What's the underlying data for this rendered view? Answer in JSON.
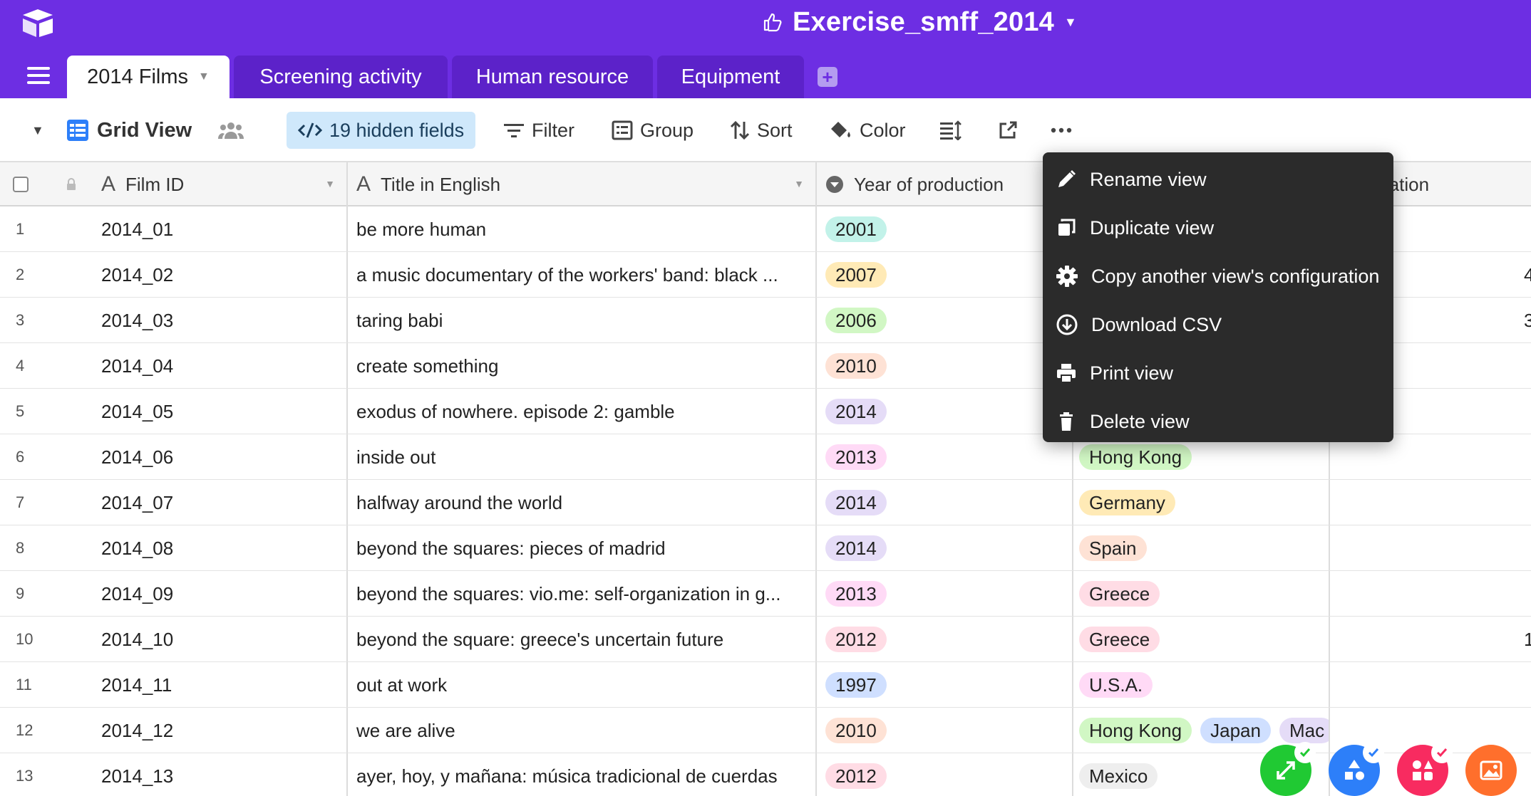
{
  "app": {
    "base_title": "Exercise_smff_2014",
    "brand_color": "#6d2ee3"
  },
  "tabs": [
    {
      "label": "2014 Films",
      "active": true
    },
    {
      "label": "Screening activity",
      "active": false
    },
    {
      "label": "Human resource",
      "active": false
    },
    {
      "label": "Equipment",
      "active": false
    }
  ],
  "toolbar": {
    "view_name": "Grid View",
    "hidden_fields": "19 hidden fields",
    "filter": "Filter",
    "group": "Group",
    "sort": "Sort",
    "color": "Color"
  },
  "columns": {
    "film_id": "Film ID",
    "title": "Title in English",
    "year": "Year of production",
    "duration_partial": "ration"
  },
  "rows": [
    {
      "num": "1",
      "id": "2014_01",
      "title": "be more human",
      "year": "2001",
      "year_color": "#c2f2e9",
      "countries": []
    },
    {
      "num": "2",
      "id": "2014_02",
      "title": "a music documentary of the workers' band: black ...",
      "year": "2007",
      "year_color": "#ffeab6",
      "countries": [],
      "edge": "4"
    },
    {
      "num": "3",
      "id": "2014_03",
      "title": "taring babi",
      "year": "2006",
      "year_color": "#d1f7c4",
      "countries": [],
      "edge": "3"
    },
    {
      "num": "4",
      "id": "2014_04",
      "title": "create something",
      "year": "2010",
      "year_color": "#fee2d5",
      "countries": []
    },
    {
      "num": "5",
      "id": "2014_05",
      "title": "exodus of nowhere. episode 2: gamble",
      "year": "2014",
      "year_color": "#e5dcf7",
      "countries": []
    },
    {
      "num": "6",
      "id": "2014_06",
      "title": "inside out",
      "year": "2013",
      "year_color": "#ffdaf6",
      "countries": [
        {
          "name": "Hong Kong",
          "color": "#d1f7c4"
        }
      ]
    },
    {
      "num": "7",
      "id": "2014_07",
      "title": "halfway around the world",
      "year": "2014",
      "year_color": "#e5dcf7",
      "countries": [
        {
          "name": "Germany",
          "color": "#ffeab6"
        }
      ]
    },
    {
      "num": "8",
      "id": "2014_08",
      "title": "beyond the squares: pieces of madrid",
      "year": "2014",
      "year_color": "#e5dcf7",
      "countries": [
        {
          "name": "Spain",
          "color": "#fee2d5"
        }
      ]
    },
    {
      "num": "9",
      "id": "2014_09",
      "title": "beyond the squares: vio.me: self-organization in g...",
      "year": "2013",
      "year_color": "#ffdaf6",
      "countries": [
        {
          "name": "Greece",
          "color": "#ffdce5"
        }
      ]
    },
    {
      "num": "10",
      "id": "2014_10",
      "title": "beyond the square: greece's uncertain future",
      "year": "2012",
      "year_color": "#ffdce5",
      "countries": [
        {
          "name": "Greece",
          "color": "#ffdce5"
        }
      ],
      "edge": "1"
    },
    {
      "num": "11",
      "id": "2014_11",
      "title": "out at work",
      "year": "1997",
      "year_color": "#cfdfff",
      "countries": [
        {
          "name": "U.S.A.",
          "color": "#ffdaf6"
        }
      ]
    },
    {
      "num": "12",
      "id": "2014_12",
      "title": "we are alive",
      "year": "2010",
      "year_color": "#fee2d5",
      "countries": [
        {
          "name": "Hong Kong",
          "color": "#d1f7c4"
        },
        {
          "name": "Japan",
          "color": "#cfdfff"
        },
        {
          "name": "Mac",
          "color": "#e5dcf7"
        }
      ]
    },
    {
      "num": "13",
      "id": "2014_13",
      "title": "ayer, hoy, y mañana: música tradicional de cuerdas",
      "year": "2012",
      "year_color": "#ffdce5",
      "countries": [
        {
          "name": "Mexico",
          "color": "#eeeeee"
        }
      ]
    }
  ],
  "menu": {
    "rename": "Rename view",
    "duplicate": "Duplicate view",
    "copy_config": "Copy another view's configuration",
    "download": "Download CSV",
    "print": "Print view",
    "delete": "Delete view"
  },
  "fab_colors": [
    "#20c933",
    "#2d7ff9",
    "#f82b60",
    "#ff6f2c"
  ]
}
